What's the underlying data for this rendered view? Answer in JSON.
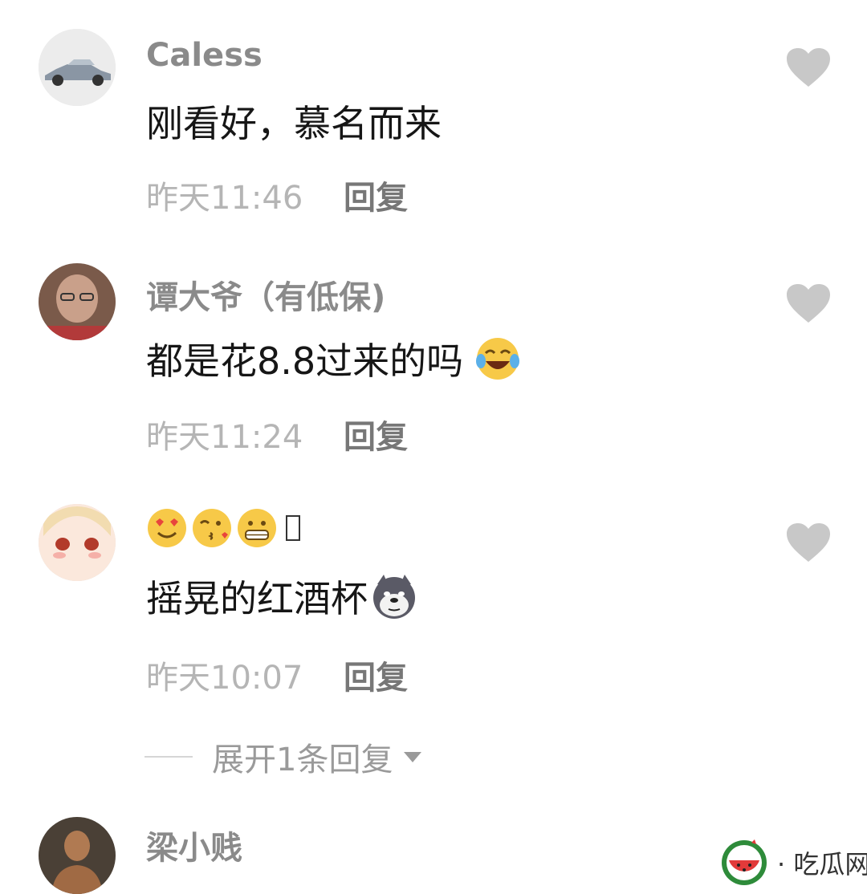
{
  "comments": [
    {
      "username": "Caless",
      "text": "刚看好，慕名而来",
      "time": "昨天11:46",
      "reply": "回复"
    },
    {
      "username": "谭大爷（有低保)",
      "text": "都是花8.8过来的吗",
      "time": "昨天11:24",
      "reply": "回复"
    },
    {
      "username": "",
      "text": "摇晃的红酒杯",
      "time": "昨天10:07",
      "reply": "回复",
      "expand": "展开1条回复"
    },
    {
      "username": "梁小贱",
      "text": "",
      "time": "",
      "reply": ""
    }
  ],
  "watermark": {
    "text": "· 吃瓜网 ·"
  },
  "icons": {
    "like": "heart-icon",
    "laugh": "tears-of-joy-emoji",
    "dog": "doge-emoji",
    "name_emojis": [
      "heart-eyes-emoji",
      "kissing-emoji",
      "grimacing-emoji"
    ]
  },
  "colors": {
    "username": "#8a8a8a",
    "text": "#161616",
    "time": "#b5b5b5",
    "heart": "#c8c8c8"
  }
}
